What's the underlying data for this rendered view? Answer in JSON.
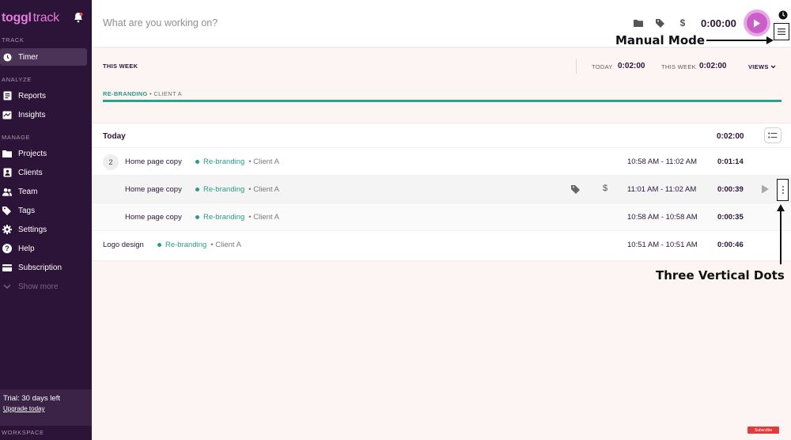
{
  "brand": {
    "logo_main": "toggl",
    "logo_sub": "track"
  },
  "sidebar": {
    "sections": {
      "track": "TRACK",
      "analyze": "ANALYZE",
      "manage": "MANAGE",
      "workspace": "WORKSPACE"
    },
    "items": [
      {
        "label": "Timer",
        "icon": "clock-icon"
      },
      {
        "label": "Reports",
        "icon": "reports-icon"
      },
      {
        "label": "Insights",
        "icon": "insights-icon"
      },
      {
        "label": "Projects",
        "icon": "folder-icon"
      },
      {
        "label": "Clients",
        "icon": "clients-icon"
      },
      {
        "label": "Team",
        "icon": "team-icon"
      },
      {
        "label": "Tags",
        "icon": "tag-icon"
      },
      {
        "label": "Settings",
        "icon": "gear-icon"
      },
      {
        "label": "Help",
        "icon": "help-icon"
      },
      {
        "label": "Subscription",
        "icon": "card-icon"
      },
      {
        "label": "Show more",
        "icon": "chevron-down-icon"
      }
    ],
    "trial": {
      "text": "Trial: 30 days left",
      "link": "Upgrade today"
    }
  },
  "topbar": {
    "placeholder": "What are you working on?",
    "timer": "0:00:00",
    "dollar": "$"
  },
  "week": {
    "this_week_label": "THIS WEEK",
    "today_label": "TODAY",
    "today_value": "0:02:00",
    "week_label": "THIS WEEK",
    "week_value": "0:02:00",
    "views_label": "VIEWS",
    "project": "RE-BRANDING",
    "client": "CLIENT A",
    "project_share": 1.0
  },
  "day": {
    "title": "Today",
    "total": "0:02:00"
  },
  "entries": [
    {
      "count": "2",
      "title": "Home page copy",
      "project": "Re-branding",
      "client": "Client A",
      "range": "10:58 AM - 11:02 AM",
      "duration": "0:01:14"
    },
    {
      "title": "Home page copy",
      "project": "Re-branding",
      "client": "Client A",
      "range": "11:01 AM - 11:02 AM",
      "duration": "0:00:39",
      "dollar": "$"
    },
    {
      "title": "Home page copy",
      "project": "Re-branding",
      "client": "Client A",
      "range": "10:58 AM - 10:58 AM",
      "duration": "0:00:35"
    },
    {
      "title": "Logo design",
      "project": "Re-branding",
      "client": "Client A",
      "range": "10:51 AM - 10:51 AM",
      "duration": "0:00:46"
    }
  ],
  "annotations": {
    "manual_mode": "Manual Mode",
    "three_dots": "Three Vertical Dots"
  },
  "badge": {
    "subscribe": "Subscribe"
  },
  "colors": {
    "sidebar": "#2c1338",
    "accent": "#cb5ecb",
    "project": "#2b9b86",
    "background": "#fdf5f3"
  }
}
